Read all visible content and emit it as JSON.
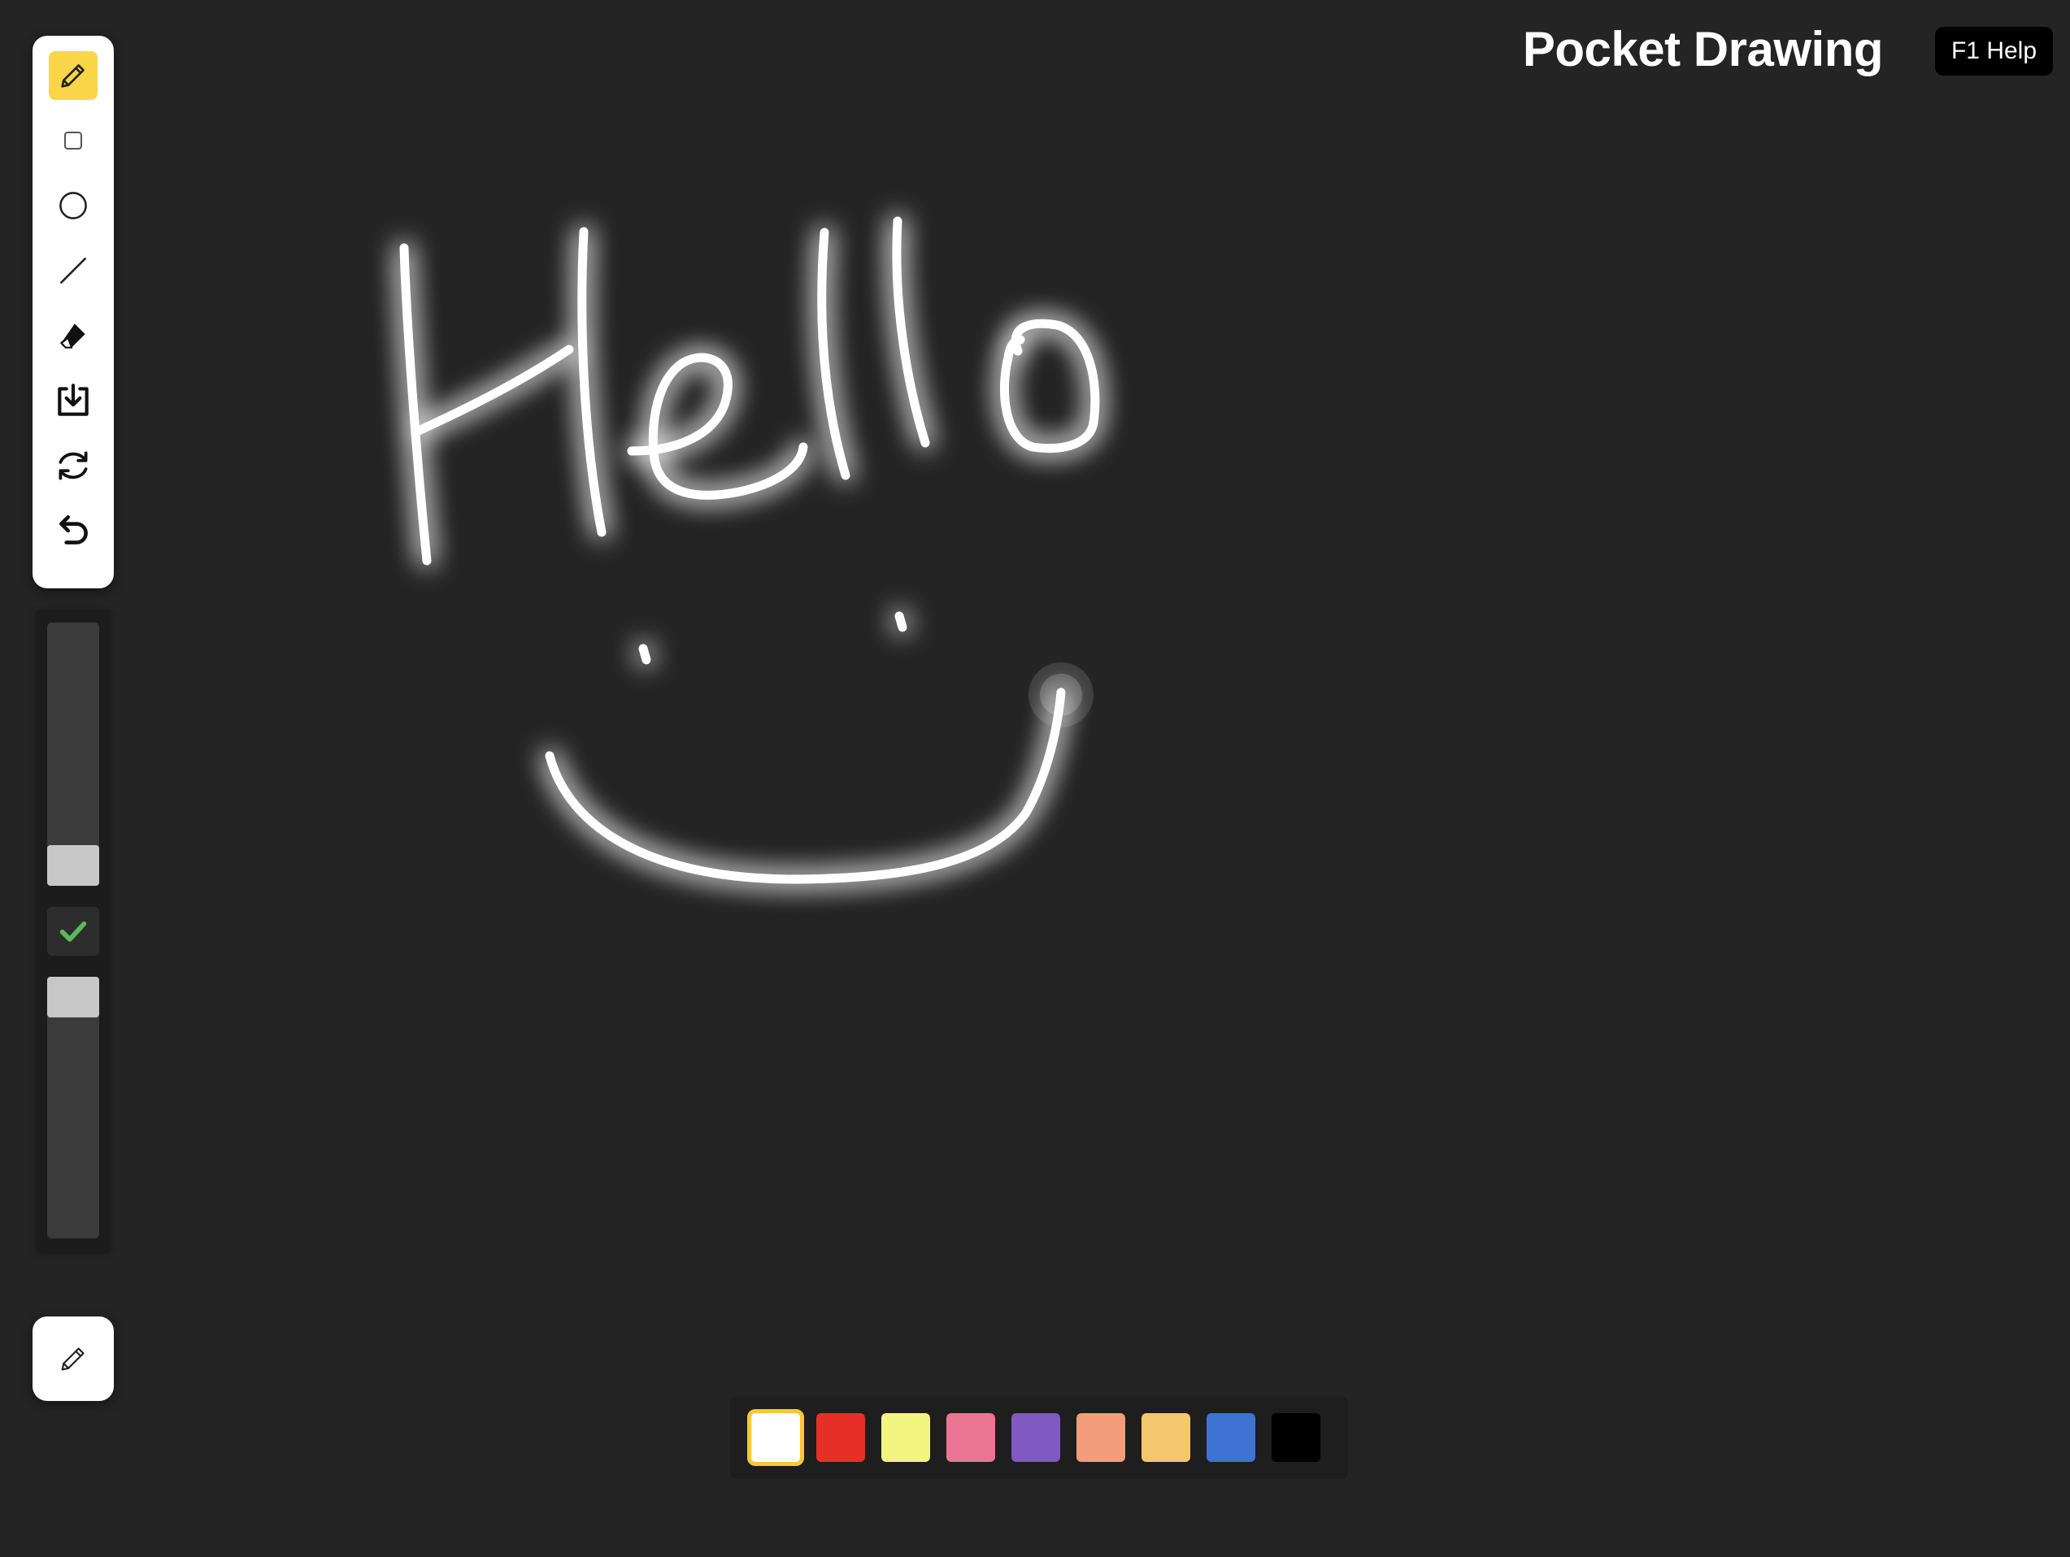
{
  "app": {
    "title": "Pocket Drawing",
    "help_label": "F1 Help",
    "background": "#242424"
  },
  "toolbar": {
    "tools": [
      {
        "name": "pencil",
        "icon": "pencil-icon",
        "active": true
      },
      {
        "name": "rectangle",
        "icon": "square-icon",
        "active": false
      },
      {
        "name": "circle",
        "icon": "circle-icon",
        "active": false
      },
      {
        "name": "line",
        "icon": "line-icon",
        "active": false
      },
      {
        "name": "eraser",
        "icon": "eraser-icon",
        "active": false
      },
      {
        "name": "save",
        "icon": "download-icon",
        "active": false
      },
      {
        "name": "clear",
        "icon": "refresh-icon",
        "active": false
      },
      {
        "name": "undo",
        "icon": "undo-icon",
        "active": false
      }
    ],
    "active_color": "#f9d548"
  },
  "size_slider": {
    "confirm_icon": "checkmark-icon",
    "confirm_color": "#5cb85c"
  },
  "pen_button": {
    "icon": "pencil-icon"
  },
  "palette": {
    "colors": [
      "#ffffff",
      "#e63027",
      "#f3f583",
      "#ea7593",
      "#7f5ac0",
      "#f39d7a",
      "#f5c76d",
      "#3e73d4",
      "#000000"
    ],
    "selected_index": 0,
    "selected_border": "#f7c736"
  },
  "drawing": {
    "stroke_color": "#ffffff"
  }
}
